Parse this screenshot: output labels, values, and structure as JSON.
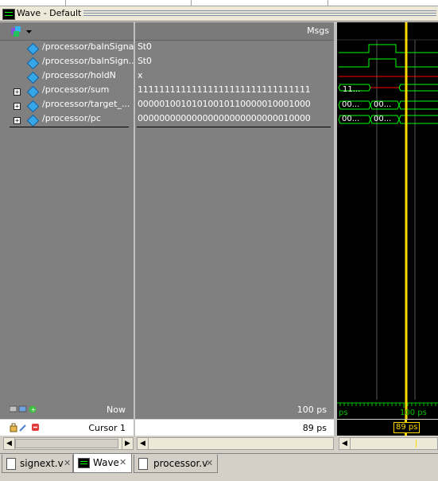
{
  "window": {
    "title": "Wave - Default"
  },
  "headers": {
    "msgs": "Msgs"
  },
  "signals": [
    {
      "name": "/processor/balnSignal",
      "value": "St0",
      "expandable": false
    },
    {
      "name": "/processor/balnSign...",
      "value": "St0",
      "expandable": false
    },
    {
      "name": "/processor/holdN",
      "value": "x",
      "expandable": false
    },
    {
      "name": "/processor/sum",
      "value": "11111111111111111111111111111111",
      "expandable": true
    },
    {
      "name": "/processor/target_...",
      "value": "00000100101010010110000010001000",
      "expandable": true
    },
    {
      "name": "/processor/pc",
      "value": "00000000000000000000000000010000",
      "expandable": true
    }
  ],
  "wave_labels": {
    "sum": "11...",
    "target_a": "00...",
    "target_b": "00...",
    "pc_a": "00...",
    "pc_b": "00..."
  },
  "status": {
    "now_label": "Now",
    "now_value": "100 ps",
    "cursor_label": "Cursor 1",
    "cursor_value": "89 ps",
    "timeline_left": "ps",
    "timeline_mark": "100 ps",
    "cursor_marker": "89 ps"
  },
  "tabs": [
    {
      "label": "signext.v",
      "active": false
    },
    {
      "label": "Wave",
      "active": true
    },
    {
      "label": "processor.v",
      "active": false
    }
  ],
  "colors": {
    "wave_green": "#00ff00",
    "wave_red": "#ff0000",
    "cursor_yellow": "#ffd800",
    "signal_diamond": "#35a7e8"
  }
}
